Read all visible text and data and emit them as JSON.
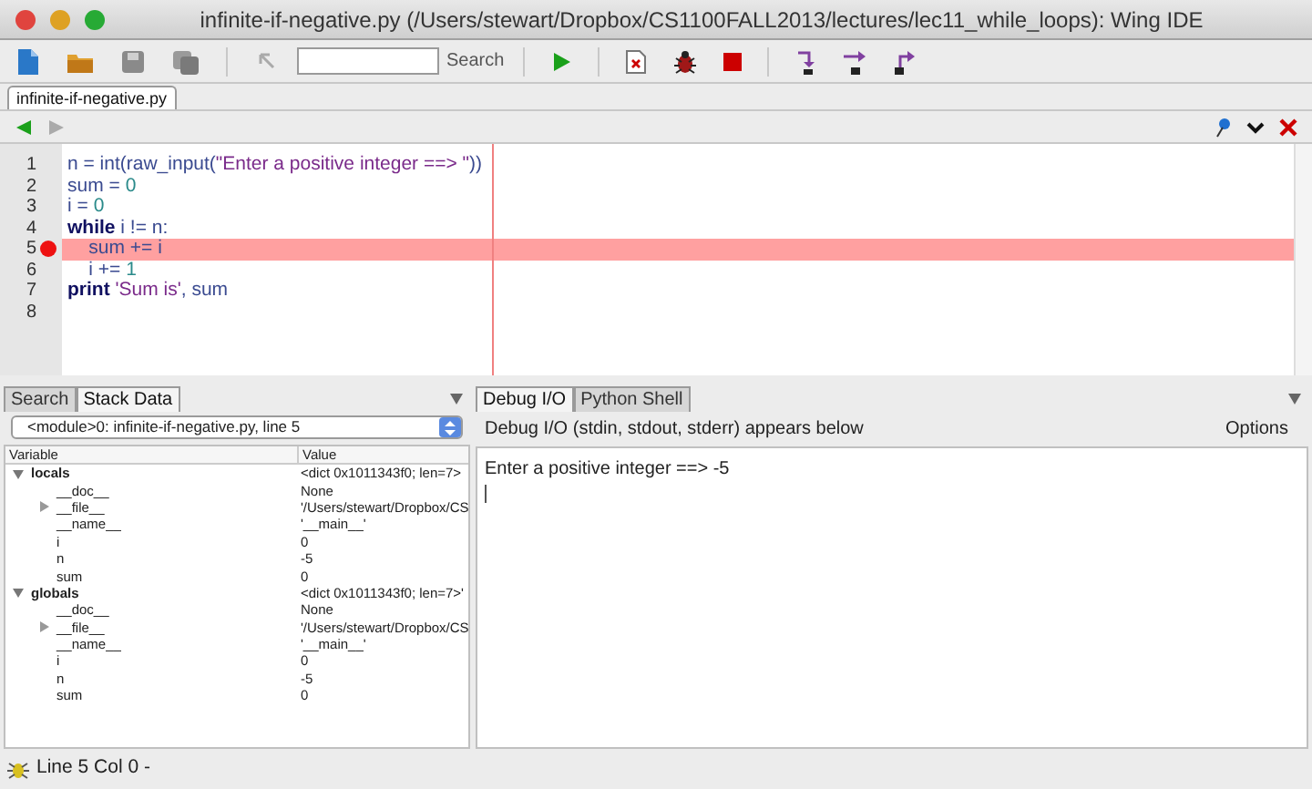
{
  "window": {
    "title": "infinite-if-negative.py (/Users/stewart/Dropbox/CS1100FALL2013/lectures/lec11_while_loops): Wing IDE"
  },
  "toolbar": {
    "search": {
      "label": "Search"
    }
  },
  "editor_tabs": [
    {
      "label": "infinite-if-negative.py",
      "selected": true
    }
  ],
  "editor": {
    "lines": [
      {
        "number": "1",
        "breakpoint": false,
        "current": false,
        "segments": [
          {
            "text": "n = int(raw_input(",
            "kind": "name"
          },
          {
            "text": "\"Enter a positive integer ==> \"",
            "kind": "string"
          },
          {
            "text": "))",
            "kind": "name"
          }
        ]
      },
      {
        "number": "2",
        "breakpoint": false,
        "current": false,
        "segments": [
          {
            "text": "sum = ",
            "kind": "name"
          },
          {
            "text": "0",
            "kind": "number"
          }
        ]
      },
      {
        "number": "3",
        "breakpoint": false,
        "current": false,
        "segments": [
          {
            "text": "i = ",
            "kind": "name"
          },
          {
            "text": "0",
            "kind": "number"
          }
        ]
      },
      {
        "number": "4",
        "breakpoint": false,
        "current": false,
        "segments": [
          {
            "text": "while",
            "kind": "keyword"
          },
          {
            "text": " i != n:",
            "kind": "name"
          }
        ]
      },
      {
        "number": "5",
        "breakpoint": true,
        "current": true,
        "segments": [
          {
            "text": "    sum += i",
            "kind": "name"
          }
        ]
      },
      {
        "number": "6",
        "breakpoint": false,
        "current": false,
        "segments": [
          {
            "text": "    i += ",
            "kind": "name"
          },
          {
            "text": "1",
            "kind": "number"
          }
        ]
      },
      {
        "number": "7",
        "breakpoint": false,
        "current": false,
        "segments": [
          {
            "text": "print",
            "kind": "keyword"
          },
          {
            "text": " 'Sum is'",
            "kind": "string"
          },
          {
            "text": ", sum",
            "kind": "name"
          }
        ]
      },
      {
        "number": "8",
        "breakpoint": false,
        "current": false
      }
    ]
  },
  "left_tabs": [
    {
      "label": "Search",
      "selected": false
    },
    {
      "label": "Stack Data",
      "selected": true
    }
  ],
  "stack_frame": "<module>0: infinite-if-negative.py, line 5",
  "stack_columns": [
    "Variable",
    "Value"
  ],
  "stack_tree": [
    {
      "name": "locals",
      "value": "<dict 0x1011343f0; len=7>",
      "expanded": true,
      "children": [
        {
          "name": "__doc__",
          "value": "None"
        },
        {
          "name": "__file__",
          "value": "'/Users/stewart/Dropbox/CS",
          "expanded": false
        },
        {
          "name": "__name__",
          "value": "'__main__'"
        },
        {
          "name": "i",
          "value": "0"
        },
        {
          "name": "n",
          "value": "-5"
        },
        {
          "name": "sum",
          "value": "0"
        }
      ]
    },
    {
      "name": "globals",
      "value": "<dict 0x1011343f0; len=7>'",
      "expanded": true,
      "children": [
        {
          "name": "__doc__",
          "value": "None"
        },
        {
          "name": "__file__",
          "value": "'/Users/stewart/Dropbox/CS",
          "expanded": false
        },
        {
          "name": "__name__",
          "value": "'__main__'"
        },
        {
          "name": "i",
          "value": "0"
        },
        {
          "name": "n",
          "value": "-5"
        },
        {
          "name": "sum",
          "value": "0"
        }
      ]
    }
  ],
  "right_tabs": [
    {
      "label": "Debug I/O",
      "selected": true
    },
    {
      "label": "Python Shell",
      "selected": false
    }
  ],
  "debug_io": {
    "header": "Debug I/O (stdin, stdout, stderr) appears below",
    "options": "Options",
    "output": "Enter a positive integer ==> -5"
  },
  "status_bar": {
    "text": "Line 5 Col 0 -"
  }
}
